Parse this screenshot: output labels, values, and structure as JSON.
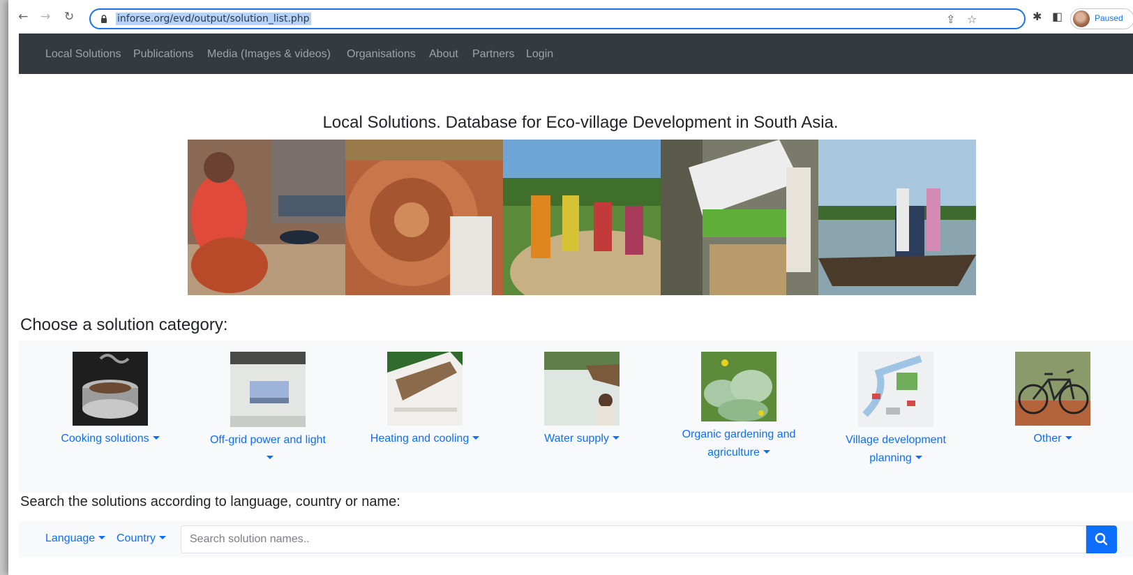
{
  "browser": {
    "url": "inforse.org/evd/output/solution_list.php",
    "profile_label": "Paused"
  },
  "nav": {
    "items": [
      "Local Solutions",
      "Publications",
      "Media (Images & videos)",
      "Organisations",
      "About",
      "Partners",
      "Login"
    ]
  },
  "page": {
    "title": "Local Solutions. Database for Eco-village Development in South Asia.",
    "choose_heading": "Choose a solution category:",
    "search_heading": "Search the solutions according to language, country or name:"
  },
  "categories": [
    {
      "label": "Cooking solutions"
    },
    {
      "label": "Off-grid power and light"
    },
    {
      "label": "Heating and cooling"
    },
    {
      "label": "Water supply"
    },
    {
      "label": "Organic gardening and agriculture"
    },
    {
      "label": "Village development planning"
    },
    {
      "label": "Other"
    }
  ],
  "search": {
    "language_label": "Language",
    "country_label": "Country",
    "placeholder": "Search solution names.."
  },
  "colors": {
    "navbar": "#343a40",
    "link": "#0d6efd",
    "panel": "#f8f9fa"
  }
}
